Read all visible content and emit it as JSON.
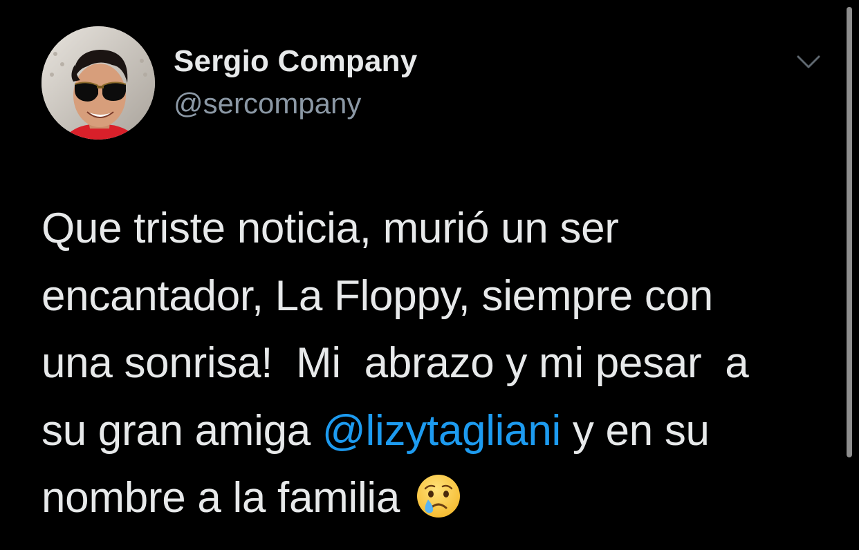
{
  "author": {
    "display_name": "Sergio Company",
    "handle": "@sercompany",
    "avatar_icon": "profile-photo"
  },
  "menu": {
    "icon": "chevron-down-icon"
  },
  "tweet": {
    "line1": "Que triste noticia, murió un ser",
    "line2": "encantador, La Floppy, siempre con",
    "line3": "una sonrisa!  Mi  abrazo y mi pesar  a",
    "line4_before": "su gran amiga ",
    "mention": "@lizytagliani",
    "line4_after": " y en su",
    "line5": "nombre a la familia",
    "emoji_icon": "crying-face-emoji"
  },
  "colors": {
    "background": "#000000",
    "text": "#e7e9ea",
    "secondary_text": "#8b98a5",
    "link": "#1d9bf0"
  }
}
